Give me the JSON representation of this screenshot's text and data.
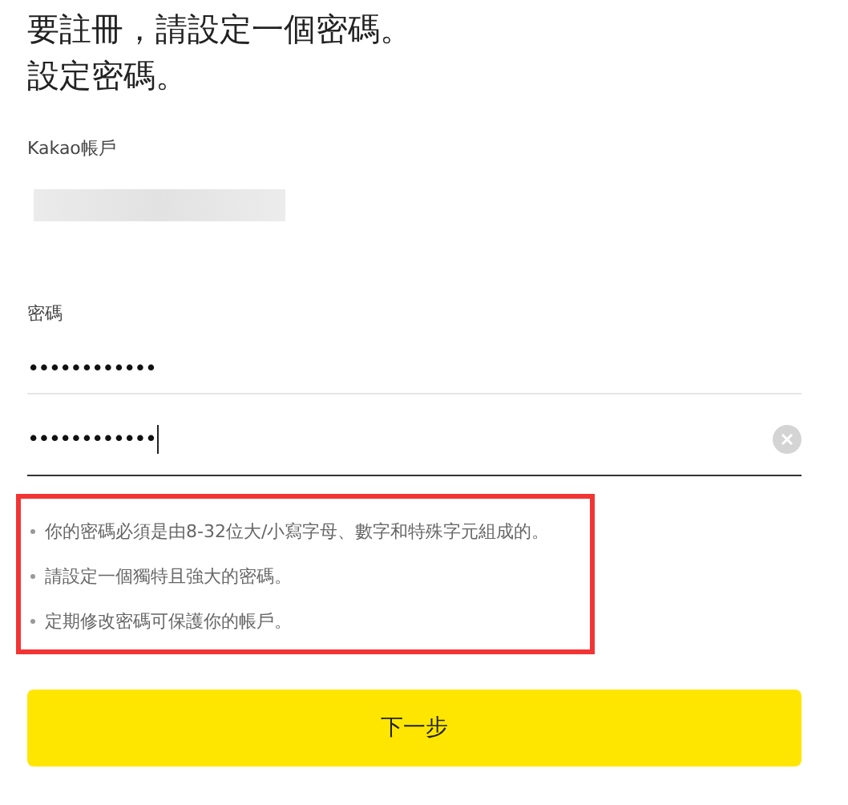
{
  "heading": [
    "要註冊，請設定一個密碼。",
    "設定密碼。"
  ],
  "account": {
    "label": "Kakao帳戶",
    "redacted": true
  },
  "password": {
    "label": "密碼",
    "fields": [
      {
        "value": "••••••••••••",
        "focused": false
      },
      {
        "value": "••••••••••••",
        "focused": true
      }
    ]
  },
  "hints": {
    "highlighted": true,
    "items": [
      "你的密碼必須是由8-32位大/小寫字母、數字和特殊字元組成的。",
      "請設定一個獨特且強大的密碼。",
      "定期修改密碼可保護你的帳戶。"
    ]
  },
  "next_button": "下一步"
}
